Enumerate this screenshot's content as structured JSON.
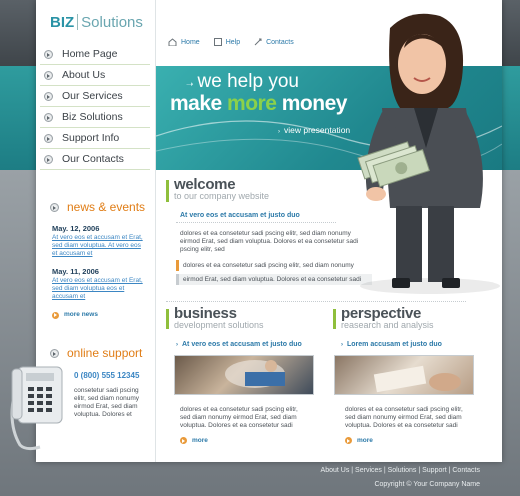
{
  "logo": {
    "biz": "BIZ",
    "solutions": "Solutions"
  },
  "nav": [
    "Home Page",
    "About Us",
    "Our Services",
    "Biz Solutions",
    "Support Info",
    "Our Contacts"
  ],
  "topbar": {
    "home": "Home",
    "help": "Help",
    "contacts": "Contacts"
  },
  "banner": {
    "line1": "we help you",
    "make": "make ",
    "more": "more",
    "money": " money",
    "view": "view presentation"
  },
  "news": {
    "title": "news & events",
    "items": [
      {
        "date": "May. 12, 2006",
        "text": "At vero eos et accusam et Erat, sed diam voluptua. At vero eos et accusam et"
      },
      {
        "date": "May. 11, 2006",
        "text": "At vero eos et accusam et Erat, sed diam voluptua eos et accusam et"
      }
    ],
    "more": "more news"
  },
  "support": {
    "title": "online support",
    "phone": "0 (800) 555 12345",
    "text": "consetetur sadi pscing elitr, sed diam nonumy eirmod Erat, sed diam voluptua. Dolores et"
  },
  "welcome": {
    "title": "welcome",
    "subtitle": "to our company website",
    "link": "At vero eos et accusam et justo duo",
    "body": "dolores et ea consetetur sadi pscing elitr, sed diam nonumy eirmod Erat, sed diam voluptua. Dolores et ea consetetur sadi pscing elitr, sed",
    "row1": "dolores et ea consetetur sadi pscing elitr, sed diam nonumy",
    "row2": "eirmod Erat, sed diam voluptua. Dolores et ea consetetur sadi"
  },
  "business": {
    "title": "business",
    "subtitle": "development solutions",
    "link": "At vero eos et accusam et justo duo",
    "body": "dolores et ea consetetur sadi pscing elitr, sed diam nonumy eirmod Erat, sed diam voluptua. Dolores et ea consetetur sadi",
    "more": "more"
  },
  "perspective": {
    "title": "perspective",
    "subtitle": "reasearch and analysis",
    "link": "Lorem accusam et justo duo",
    "body": "dolores et ea consetetur sadi pscing elitr, sed diam nonumy eirmod Erat, sed diam voluptua. Dolores et ea consetetur sadi",
    "more": "more"
  },
  "footer": {
    "links": [
      "About Us",
      "Services",
      "Solutions",
      "Support",
      "Contacts"
    ],
    "sep": " | ",
    "copyright": "Copyright © Your Company Name"
  }
}
